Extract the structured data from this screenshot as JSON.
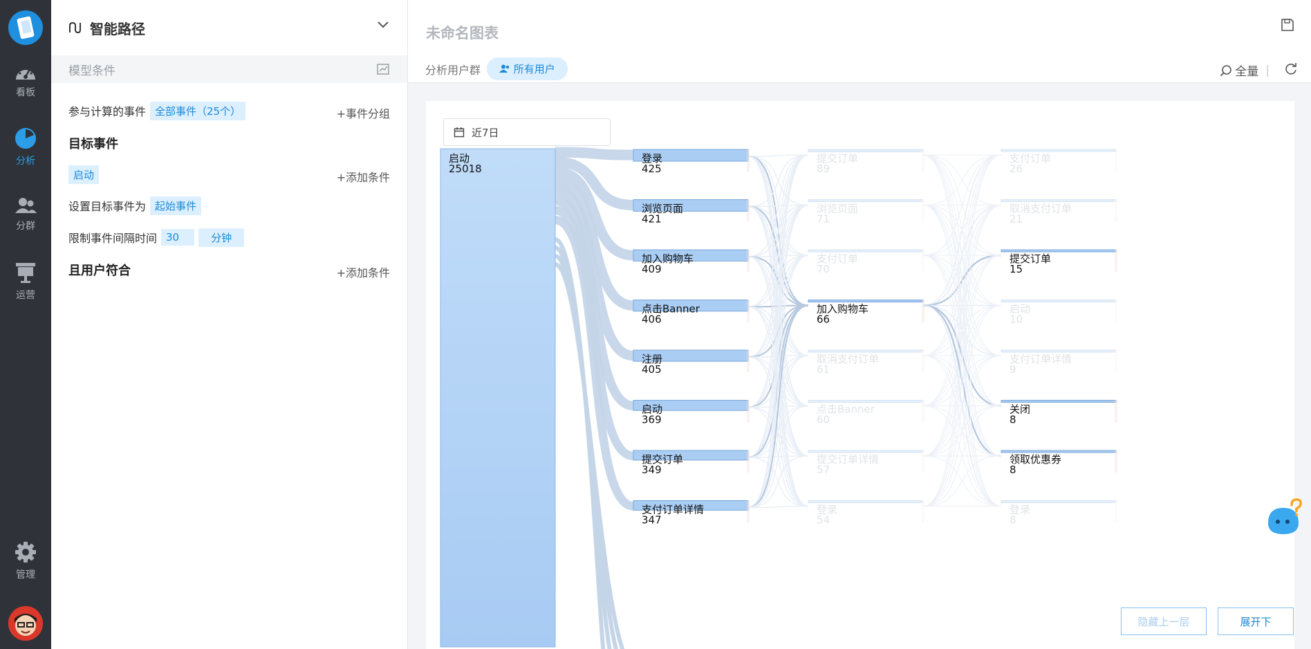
{
  "nav": {
    "items": [
      {
        "label": "看板",
        "icon": "dashboard-icon"
      },
      {
        "label": "分析",
        "icon": "pie-chart-icon"
      },
      {
        "label": "分群",
        "icon": "users-icon"
      },
      {
        "label": "运营",
        "icon": "presentation-icon"
      },
      {
        "label": "管理",
        "icon": "gear-icon"
      }
    ]
  },
  "panel": {
    "title": "智能路径",
    "subtitle": "模型条件",
    "events_label": "参与计算的事件",
    "events_tag": "全部事件（25个）",
    "event_group_link": "+事件分组",
    "target_heading": "目标事件",
    "target_tag": "启动",
    "add_condition_1": "+添加条件",
    "set_target_label": "设置目标事件为",
    "set_target_tag": "起始事件",
    "interval_label": "限制事件间隔时间",
    "interval_value": "30",
    "interval_unit": "分钟",
    "user_heading": "且用户符合",
    "add_condition_2": "+添加条件"
  },
  "main": {
    "chart_title": "未命名图表",
    "segment_label": "分析用户群",
    "segment_value": "所有用户",
    "scope_label": "全量",
    "date_range": "近7日",
    "hide_button": "隐藏上一层",
    "expand_button": "展开下"
  },
  "chart_data": {
    "type": "sankey",
    "columns": [
      [
        {
          "name": "启动",
          "value": 25018,
          "faded": false
        }
      ],
      [
        {
          "name": "登录",
          "value": 425,
          "faded": false
        },
        {
          "name": "浏览页面",
          "value": 421,
          "faded": false
        },
        {
          "name": "加入购物车",
          "value": 409,
          "faded": false
        },
        {
          "name": "点击Banner",
          "value": 406,
          "faded": false
        },
        {
          "name": "注册",
          "value": 405,
          "faded": false
        },
        {
          "name": "启动",
          "value": 369,
          "faded": false
        },
        {
          "name": "提交订单",
          "value": 349,
          "faded": false
        },
        {
          "name": "支付订单详情",
          "value": 347,
          "faded": false
        }
      ],
      [
        {
          "name": "提交订单",
          "value": 89,
          "faded": true
        },
        {
          "name": "浏览页面",
          "value": 71,
          "faded": true
        },
        {
          "name": "支付订单",
          "value": 70,
          "faded": true
        },
        {
          "name": "加入购物车",
          "value": 66,
          "faded": false
        },
        {
          "name": "取消支付订单",
          "value": 61,
          "faded": true
        },
        {
          "name": "点击Banner",
          "value": 60,
          "faded": true
        },
        {
          "name": "提交订单详情",
          "value": 57,
          "faded": true
        },
        {
          "name": "登录",
          "value": 54,
          "faded": true
        }
      ],
      [
        {
          "name": "支付订单",
          "value": 26,
          "faded": true
        },
        {
          "name": "取消支付订单",
          "value": 21,
          "faded": true
        },
        {
          "name": "提交订单",
          "value": 15,
          "faded": false
        },
        {
          "name": "启动",
          "value": 10,
          "faded": true
        },
        {
          "name": "支付订单详情",
          "value": 9,
          "faded": true
        },
        {
          "name": "关闭",
          "value": 8,
          "faded": false
        },
        {
          "name": "领取优惠券",
          "value": 8,
          "faded": false
        },
        {
          "name": "登录",
          "value": 8,
          "faded": true
        }
      ]
    ]
  },
  "colors": {
    "accent": "#1a8ad9",
    "nav_bg": "#2f3339",
    "node_fill": "#a9cdf3",
    "link": "#c9d6e6"
  }
}
